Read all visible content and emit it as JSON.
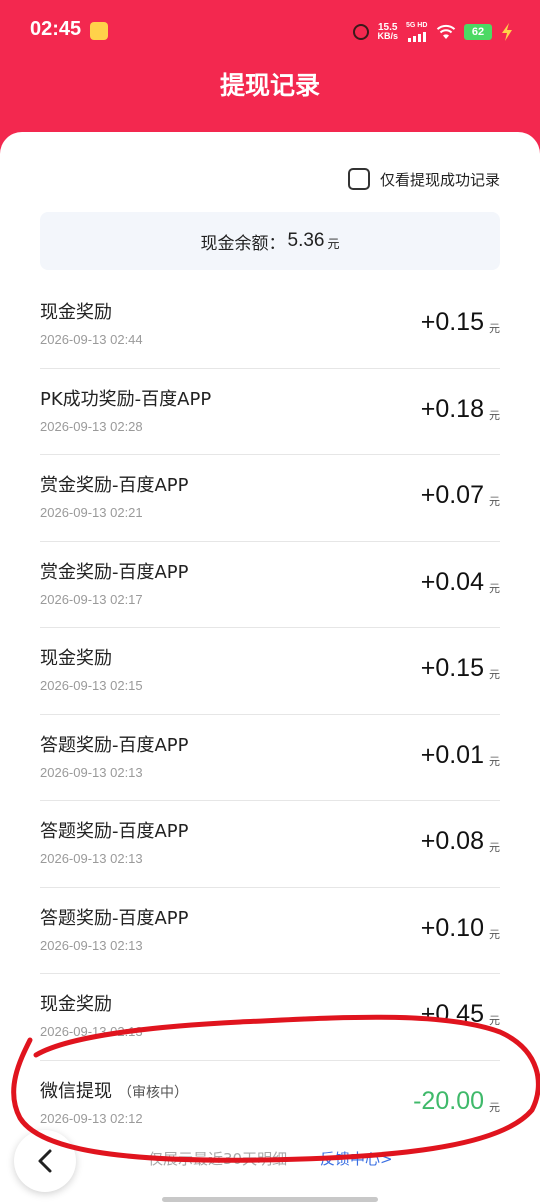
{
  "status_bar": {
    "time": "02:45",
    "net_speed_value": "15.5",
    "net_speed_unit": "KB/s",
    "network_type": "5G HD",
    "battery_level": "62"
  },
  "header": {
    "title": "提现记录"
  },
  "filter": {
    "label": "仅看提现成功记录",
    "checked": false
  },
  "balance": {
    "label": "现金余额：",
    "amount": "5.36",
    "unit": "元"
  },
  "records": [
    {
      "title": "现金奖励",
      "status": "",
      "date": "2026-09-13 02:44",
      "amount": "+0.15",
      "unit": "元"
    },
    {
      "title": "PK成功奖励-百度APP",
      "status": "",
      "date": "2026-09-13 02:28",
      "amount": "+0.18",
      "unit": "元"
    },
    {
      "title": "赏金奖励-百度APP",
      "status": "",
      "date": "2026-09-13 02:21",
      "amount": "+0.07",
      "unit": "元"
    },
    {
      "title": "赏金奖励-百度APP",
      "status": "",
      "date": "2026-09-13 02:17",
      "amount": "+0.04",
      "unit": "元"
    },
    {
      "title": "现金奖励",
      "status": "",
      "date": "2026-09-13 02:15",
      "amount": "+0.15",
      "unit": "元"
    },
    {
      "title": "答题奖励-百度APP",
      "status": "",
      "date": "2026-09-13 02:13",
      "amount": "+0.01",
      "unit": "元"
    },
    {
      "title": "答题奖励-百度APP",
      "status": "",
      "date": "2026-09-13 02:13",
      "amount": "+0.08",
      "unit": "元"
    },
    {
      "title": "答题奖励-百度APP",
      "status": "",
      "date": "2026-09-13 02:13",
      "amount": "+0.10",
      "unit": "元"
    },
    {
      "title": "现金奖励",
      "status": "",
      "date": "2026-09-13 02:13",
      "amount": "+0.45",
      "unit": "元"
    },
    {
      "title": "微信提现",
      "status": "（审核中）",
      "date": "2026-09-13 02:12",
      "amount": "-20.00",
      "unit": "元"
    }
  ],
  "footer": {
    "note": "仅展示最近30天明细",
    "link": "反馈中心>"
  },
  "colors": {
    "brand": "#f3284f",
    "negative_amount": "#3fb96a",
    "link": "#3a6fe3",
    "annotation": "#e0141e"
  },
  "icons": {
    "back": "chevron-left-icon",
    "alarm": "alarm-icon",
    "wifi": "wifi-icon",
    "signal": "signal-icon",
    "battery": "battery-icon",
    "charge": "lightning-icon"
  }
}
